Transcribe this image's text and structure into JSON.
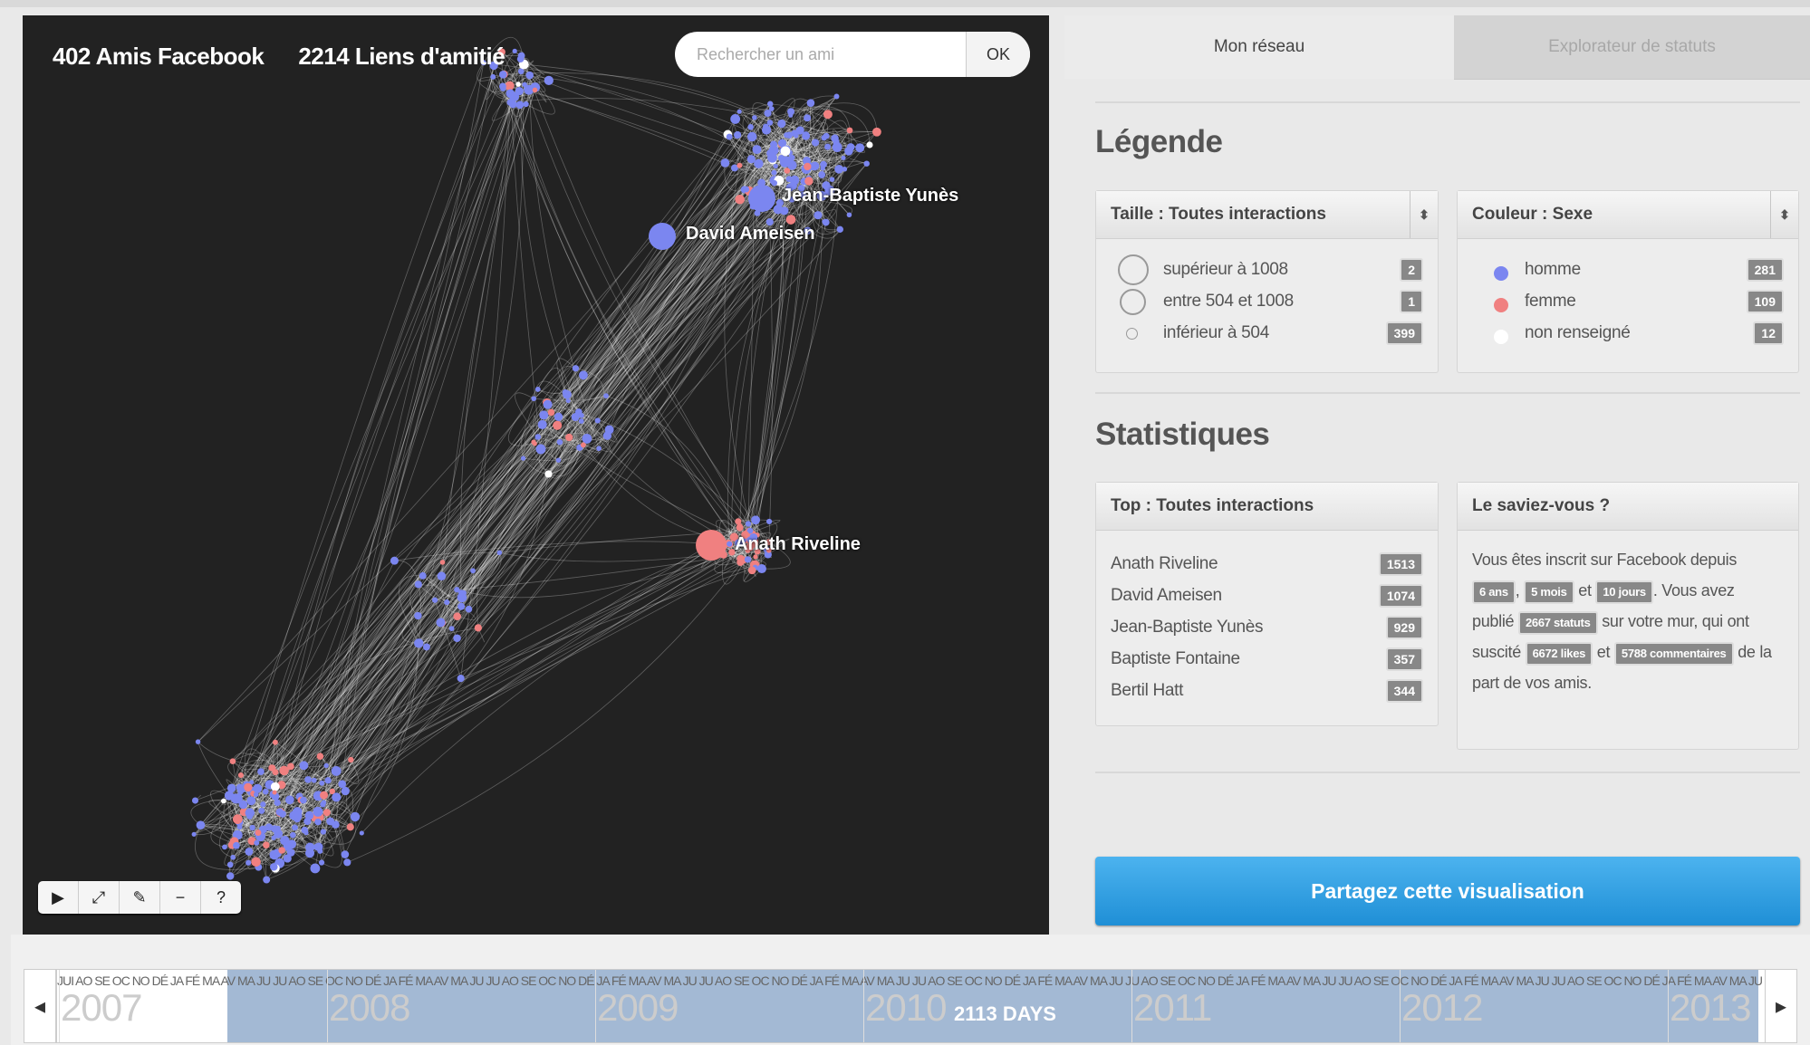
{
  "graph": {
    "friends_count": "402 Amis Facebook",
    "links_count": "2214 Liens d'amitié",
    "search_placeholder": "Rechercher un ami",
    "search_button": "OK",
    "node_labels": [
      "Jean-Baptiste Yunès",
      "David Ameisen",
      "Anath Riveline"
    ],
    "tool_icons": [
      "play-icon",
      "expand-icon",
      "tag-icon",
      "minus-icon",
      "help-icon"
    ]
  },
  "tabs": {
    "network": "Mon réseau",
    "explorer": "Explorateur de statuts"
  },
  "legend": {
    "title": "Légende",
    "size_select": "Taille : Toutes interactions",
    "size_rows": [
      {
        "label": "supérieur à 1008",
        "count": "2"
      },
      {
        "label": "entre 504 et 1008",
        "count": "1"
      },
      {
        "label": "inférieur à 504",
        "count": "399"
      }
    ],
    "color_select": "Couleur : Sexe",
    "color_rows": [
      {
        "label": "homme",
        "count": "281",
        "color": "#7b86f0"
      },
      {
        "label": "femme",
        "count": "109",
        "color": "#f08080"
      },
      {
        "label": "non renseigné",
        "count": "12",
        "color": "#ffffff"
      }
    ]
  },
  "stats": {
    "title": "Statistiques",
    "top_title": "Top : Toutes interactions",
    "top_rows": [
      {
        "label": "Anath Riveline",
        "count": "1513"
      },
      {
        "label": "David Ameisen",
        "count": "1074"
      },
      {
        "label": "Jean-Baptiste Yunès",
        "count": "929"
      },
      {
        "label": "Baptiste Fontaine",
        "count": "357"
      },
      {
        "label": "Bertil Hatt",
        "count": "344"
      }
    ],
    "didyouknow_title": "Le saviez-vous ?",
    "dyk": {
      "t1": "Vous êtes inscrit sur Facebook depuis",
      "years": "6 ans",
      "months": "5 mois",
      "and": "et",
      "days": "10 jours",
      "t2": "Vous avez publié",
      "statuses": "2667 statuts",
      "t3": "sur votre mur, qui ont suscité",
      "likes": "6672 likes",
      "comments": "5788 commentaires",
      "t4": "de la part de vos amis."
    }
  },
  "share_button": "Partagez cette visualisation",
  "timeline": {
    "months": "JUI AO SE OC NO DÉ JA FÉ MA AV MA JU JU AO SE OC NO DÉ JA FÉ MA AV MA JU JU AO SE OC NO DÉ JA FÉ MA AV MA JU JU AO SE OC NO DÉ JA FÉ MA AV MA JU JU AO SE OC NO DÉ JA FÉ MA AV MA JU JU AO SE OC NO DÉ JA FÉ MA AV MA JU JU AO SE OC NO DÉ JA FÉ MA AV MA JU JU AO SE OC NO DÉ JA FÉ MA AV MA JU JU AO SE OC N",
    "years": [
      "2007",
      "2008",
      "2009",
      "2010",
      "2011",
      "2012",
      "2013"
    ],
    "range_label": "2113 DAYS"
  }
}
